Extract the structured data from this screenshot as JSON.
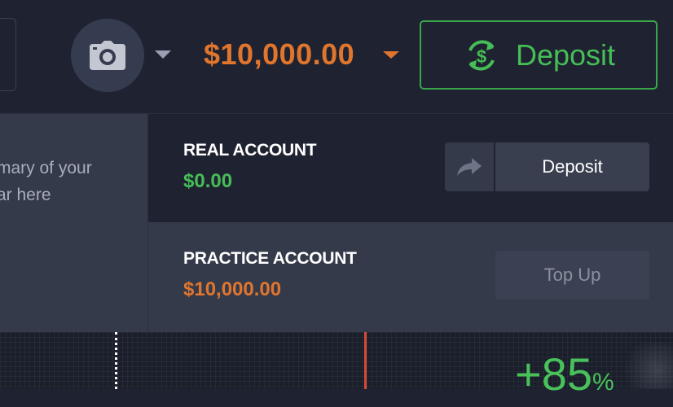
{
  "header": {
    "balance": "$10,000.00",
    "deposit_label": "Deposit",
    "icons": {
      "avatar": "camera-icon",
      "avatar_caret": "chevron-down-icon",
      "balance_caret": "chevron-down-icon",
      "deposit": "dollar-exchange-icon"
    }
  },
  "side_panel": {
    "line1": "mary of your",
    "line2": "ar here"
  },
  "accounts": {
    "real": {
      "name": "REAL ACCOUNT",
      "amount": "$0.00",
      "amount_color": "#46bd56",
      "action_label": "Deposit",
      "share_icon": "share-arrow-icon"
    },
    "practice": {
      "name": "PRACTICE ACCOUNT",
      "amount": "$10,000.00",
      "amount_color": "#e0752d",
      "action_label": "Top Up"
    }
  },
  "chart": {
    "payout_value": "+85",
    "payout_unit": "%"
  },
  "colors": {
    "background": "#1f2331",
    "panel": "#353a4b",
    "accent_orange": "#e0752d",
    "accent_green": "#46bd56"
  }
}
